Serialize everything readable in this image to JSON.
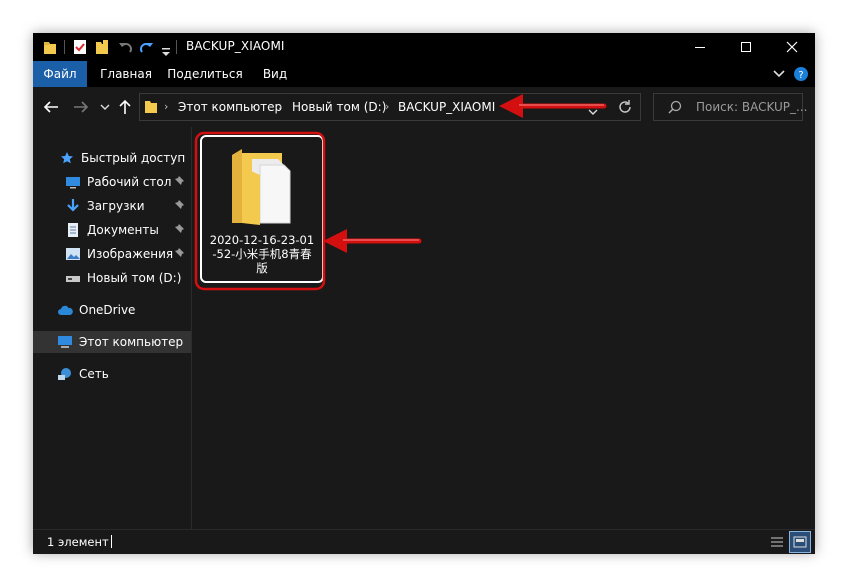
{
  "window": {
    "title": "BACKUP_XIAOMI"
  },
  "ribbon": {
    "tabs": [
      {
        "label": "Файл",
        "active": true
      },
      {
        "label": "Главная"
      },
      {
        "label": "Поделиться"
      },
      {
        "label": "Вид"
      }
    ]
  },
  "address": {
    "crumbs": [
      "Этот компьютер",
      "Новый том (D:)",
      "BACKUP_XIAOMI"
    ]
  },
  "search": {
    "placeholder": "Поиск: BACKUP_..."
  },
  "nav": {
    "quick_access": "Быстрый доступ",
    "items": [
      {
        "label": "Рабочий стол",
        "icon": "desktop-icon",
        "pinned": true
      },
      {
        "label": "Загрузки",
        "icon": "downloads-icon",
        "pinned": true
      },
      {
        "label": "Документы",
        "icon": "documents-icon",
        "pinned": true
      },
      {
        "label": "Изображения",
        "icon": "pictures-icon",
        "pinned": true
      },
      {
        "label": "Новый том (D:)",
        "icon": "drive-icon",
        "pinned": false
      }
    ],
    "onedrive": "OneDrive",
    "this_pc": "Этот компьютер",
    "network": "Сеть"
  },
  "content": {
    "items": [
      {
        "name": "2020-12-16-23-01-52-小米手机8青春版",
        "icon": "folder-icon"
      }
    ]
  },
  "status": {
    "count": "1 элемент"
  },
  "colors": {
    "background": "#191919",
    "titlebar": "#000000",
    "file_tab": "#1a5fa8",
    "accent_blue": "#4aa3ff",
    "annotation_red": "#d30f0f",
    "folder_yellow": "#f3c94e"
  }
}
